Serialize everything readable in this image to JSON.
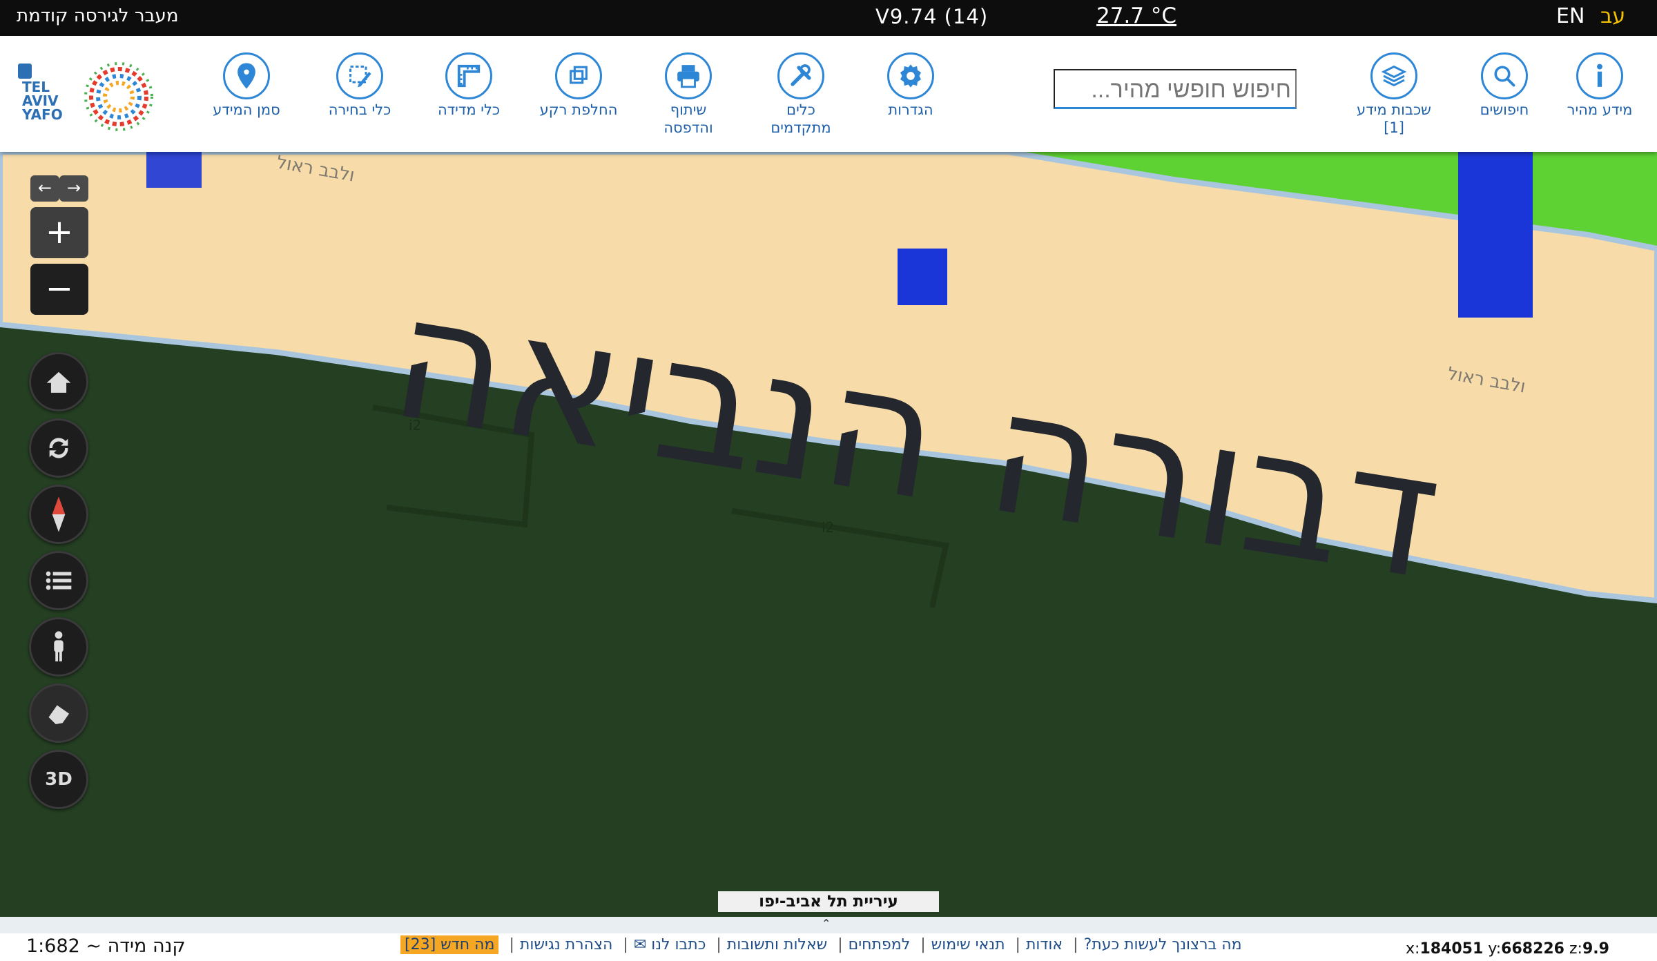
{
  "topbar": {
    "prev_version": "מעבר לגירסה קודמת",
    "version": "V9.74 (14)",
    "temperature": "27.7 °C",
    "lang_en": "EN",
    "lang_he": "עב"
  },
  "toolbar": {
    "logo_text": "TEL AVIV YAFO",
    "search_placeholder": "חיפוש חופשי מהיר...",
    "tools": [
      {
        "label": "סמן המידע",
        "icon": "marker-icon"
      },
      {
        "label": "כלי בחירה",
        "icon": "selection-icon"
      },
      {
        "label": "כלי מדידה",
        "icon": "ruler-icon"
      },
      {
        "label": "החלפת רקע",
        "icon": "layers-swap-icon"
      },
      {
        "label": "שיתוף והדפסה",
        "icon": "printer-icon"
      },
      {
        "label": "כלים מתקדמים",
        "icon": "tools-icon"
      },
      {
        "label": "הגדרות",
        "icon": "gear-icon"
      },
      {
        "label": "שכבות מידע [1]",
        "icon": "layers-icon"
      },
      {
        "label": "חיפושים",
        "icon": "search-icon"
      },
      {
        "label": "מידע מהיר",
        "icon": "info-icon"
      }
    ]
  },
  "map": {
    "street_label": "דבורה הנביאה",
    "small_labels": [
      "ולבב ראול",
      "ולבב ראול",
      "i2",
      "i2"
    ],
    "controls": {
      "zoom_in": "+",
      "zoom_out": "−",
      "three_d": "3D",
      "nav_back": "←",
      "nav_forward": "→"
    },
    "colors": {
      "dark_area": "#243f22",
      "road": "#f7dcaa",
      "green": "#5ed233",
      "building_blue": "#1b36d8"
    }
  },
  "footer": {
    "city_label": "עיריית תל אביב-יפו",
    "scale": "קנה מידה ~ 1:682",
    "links": [
      "מה ברצונך לעשות כעת?",
      "אודות",
      "תנאי שימוש",
      "למפתחים",
      "שאלות ותשובות",
      "כתבו לנו ✉",
      "הצהרת נגישות"
    ],
    "whats_new": "מה חדש [23]",
    "coords": {
      "x_label": "x:",
      "x": "184051",
      "y_label": "y:",
      "y": "668226",
      "z_label": "z:",
      "z": "9.9"
    }
  }
}
